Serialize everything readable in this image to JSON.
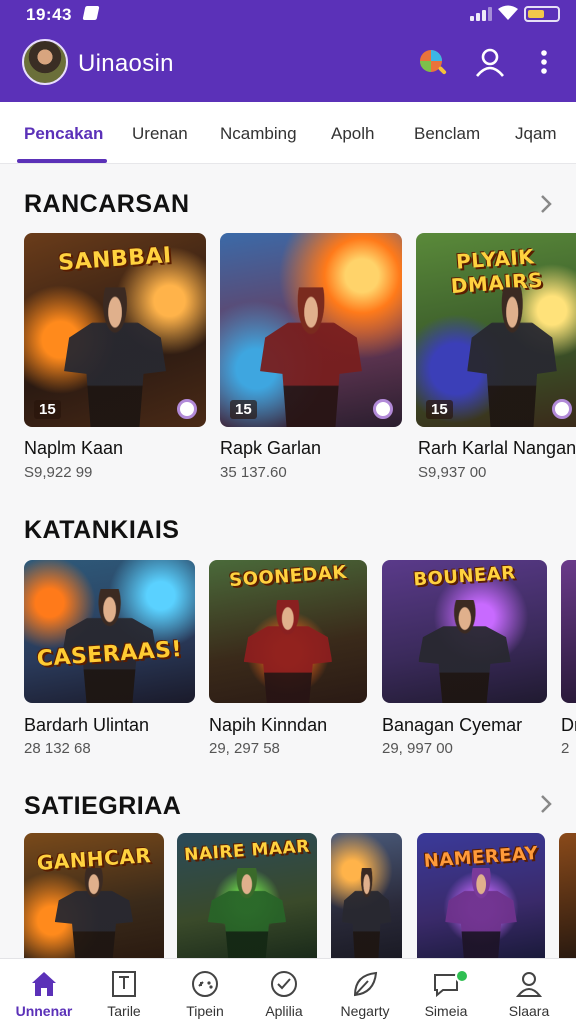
{
  "status_bar": {
    "time": "19:43"
  },
  "header": {
    "title": "Uinaosin"
  },
  "tabs": [
    {
      "label": "Pencakan",
      "active": true
    },
    {
      "label": "Urenan"
    },
    {
      "label": "Ncambing"
    },
    {
      "label": "Apolh"
    },
    {
      "label": "Benclam"
    },
    {
      "label": "Jqam"
    }
  ],
  "sections": [
    {
      "title": "RANCARSAN",
      "cards": [
        {
          "art_title": "SANBBAI",
          "badge": "15",
          "name": "Naplm Kaan",
          "price": "S9,922 99"
        },
        {
          "art_title": "",
          "badge": "15",
          "name": "Rapk Garlan",
          "price": "35 137.60"
        },
        {
          "art_title": "PLYAIK DMAIRS",
          "badge": "15",
          "name": "Rarh Karlal Nangan",
          "price": "S9,937 00"
        }
      ]
    },
    {
      "title": "KATANKIAIS",
      "cards": [
        {
          "art_title": "CASERAAS!",
          "name": "Bardarh Ulintan",
          "price": "28 132 68"
        },
        {
          "art_title": "SOONEDAK",
          "name": "Napih Kinndan",
          "price": "29, 297 58"
        },
        {
          "art_title": "BOUNEAR",
          "name": "Banagan Cyemar",
          "price": "29, 997 00"
        },
        {
          "art_title": "",
          "name": "Dr",
          "price": "2"
        }
      ]
    },
    {
      "title": "SATIEGRIAA",
      "cards": [
        {
          "art_title": "GANHCAR"
        },
        {
          "art_title": "NAIRE MAAR"
        },
        {
          "art_title": ""
        },
        {
          "art_title": "NAMEREAY"
        },
        {
          "art_title": ""
        }
      ]
    }
  ],
  "bottom_nav": [
    {
      "label": "Unnenar",
      "icon": "home-icon",
      "active": true
    },
    {
      "label": "Tarile",
      "icon": "book-icon"
    },
    {
      "label": "Tipein",
      "icon": "gamepad-icon"
    },
    {
      "label": "Aplilia",
      "icon": "check-circle-icon"
    },
    {
      "label": "Negarty",
      "icon": "leaf-icon"
    },
    {
      "label": "Simeia",
      "icon": "chat-icon"
    },
    {
      "label": "Slaara",
      "icon": "profile-icon"
    }
  ],
  "colors": {
    "accent": "#5b31b8",
    "background": "#f7f7f8",
    "notification": "#2fbf52"
  }
}
